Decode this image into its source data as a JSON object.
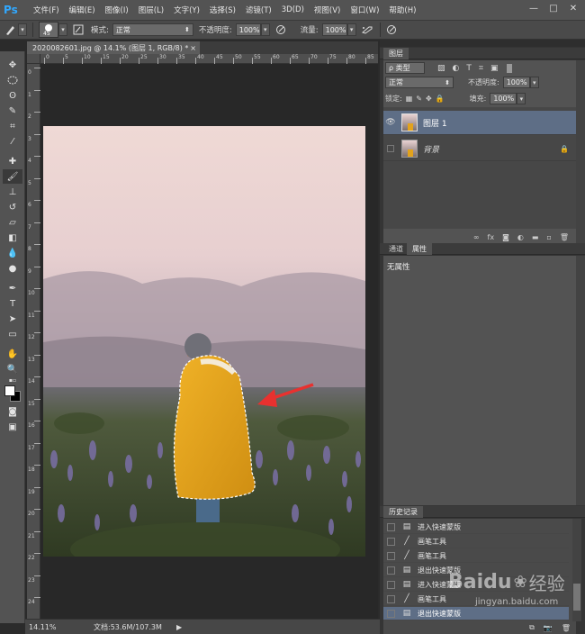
{
  "app": {
    "logo": "Ps"
  },
  "menu": [
    "文件(F)",
    "编辑(E)",
    "图像(I)",
    "图层(L)",
    "文字(Y)",
    "选择(S)",
    "滤镜(T)",
    "3D(D)",
    "视图(V)",
    "窗口(W)",
    "帮助(H)"
  ],
  "window_controls": {
    "minimize": "—",
    "maximize": "□",
    "close": "✕"
  },
  "options": {
    "brush_size": "45",
    "mode_label": "模式:",
    "mode_value": "正常",
    "opacity_label": "不透明度:",
    "opacity_value": "100%",
    "flow_label": "流量:",
    "flow_value": "100%"
  },
  "document": {
    "tab_title": "2020082601.jpg @ 14.1% (图层 1, RGB/8) *",
    "tab_close": "×",
    "zoom": "14.11%",
    "doc_size": "文档:53.6M/107.3M"
  },
  "ruler_top_labels": [
    "0",
    "5",
    "10",
    "15",
    "20",
    "25",
    "30",
    "35",
    "40",
    "45",
    "50",
    "55",
    "60",
    "65",
    "70",
    "75",
    "80",
    "85"
  ],
  "ruler_left_labels": [
    "0",
    "1",
    "2",
    "3",
    "4",
    "5",
    "6",
    "7",
    "8",
    "9",
    "10",
    "11",
    "12",
    "13",
    "14",
    "15",
    "16",
    "17",
    "18",
    "19",
    "20",
    "21",
    "22",
    "23",
    "24"
  ],
  "layers_panel": {
    "tab": "图层",
    "filter_label": "ρ 类型",
    "blend_mode": "正常",
    "opacity_label": "不透明度:",
    "opacity_value": "100%",
    "lock_label": "锁定:",
    "fill_label": "填充:",
    "fill_value": "100%",
    "layers": [
      {
        "name": "图层 1",
        "visible": true,
        "selected": true
      },
      {
        "name": "背景",
        "visible": false,
        "selected": false,
        "locked": true
      }
    ]
  },
  "properties_panel": {
    "tabs": [
      "通道",
      "属性"
    ],
    "active_tab": "属性",
    "content": "无属性"
  },
  "history_panel": {
    "tab": "历史记录",
    "items": [
      "进入快速蒙版",
      "画笔工具",
      "画笔工具",
      "退出快速蒙版",
      "进入快速蒙版",
      "画笔工具",
      "退出快速蒙版"
    ],
    "selected_index": 6
  },
  "watermark": {
    "text1": "Baidu",
    "text2": "经验",
    "url": "jingyan.baidu.com"
  },
  "colors": {
    "accent": "#31a8ff",
    "selected_layer": "#5e6e86",
    "coat": "#e2a21c",
    "arrow": "#e8312f"
  }
}
